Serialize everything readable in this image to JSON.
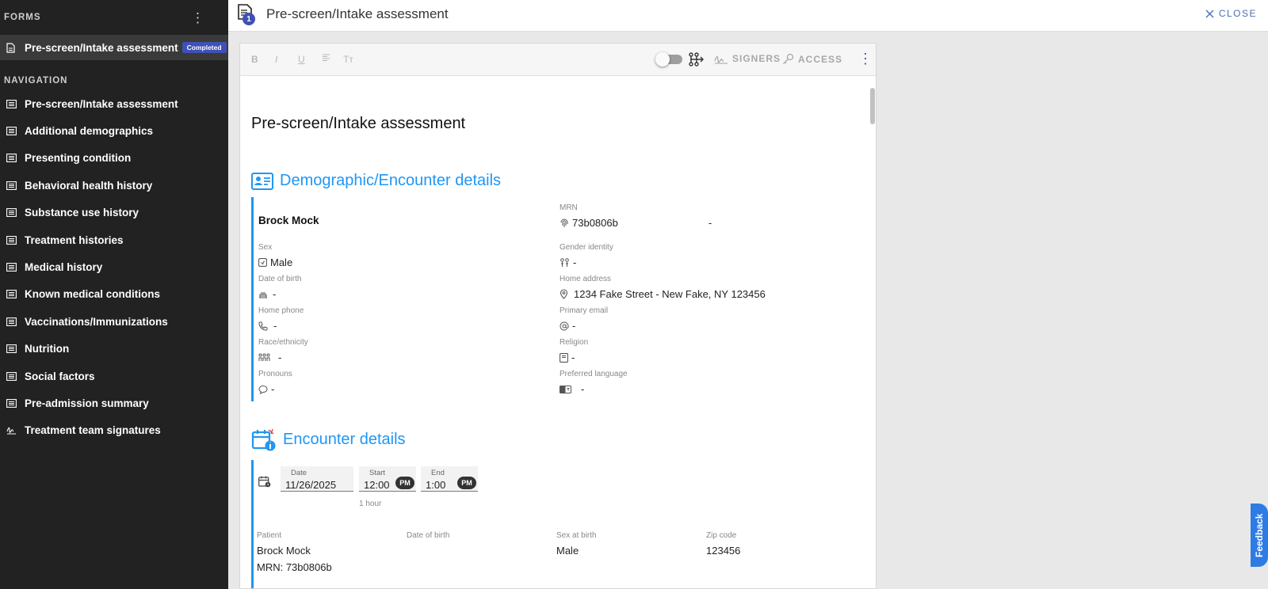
{
  "sidebar": {
    "forms_title": "FORMS",
    "form_item": {
      "label": "Pre-screen/Intake assessment",
      "badge": "Completed"
    },
    "nav_title": "NAVIGATION",
    "nav_items": [
      {
        "label": "Pre-screen/Intake assessment",
        "icon": "list-icon"
      },
      {
        "label": "Additional demographics",
        "icon": "list-icon"
      },
      {
        "label": "Presenting condition",
        "icon": "list-icon"
      },
      {
        "label": "Behavioral health history",
        "icon": "list-icon"
      },
      {
        "label": "Substance use history",
        "icon": "list-icon"
      },
      {
        "label": "Treatment histories",
        "icon": "list-icon"
      },
      {
        "label": "Medical history",
        "icon": "list-icon"
      },
      {
        "label": "Known medical conditions",
        "icon": "list-icon"
      },
      {
        "label": "Vaccinations/Immunizations",
        "icon": "list-icon"
      },
      {
        "label": "Nutrition",
        "icon": "list-icon"
      },
      {
        "label": "Social factors",
        "icon": "list-icon"
      },
      {
        "label": "Pre-admission summary",
        "icon": "list-icon"
      },
      {
        "label": "Treatment team signatures",
        "icon": "signature-icon"
      }
    ]
  },
  "topbar": {
    "title": "Pre-screen/Intake assessment",
    "doc_count": "1",
    "close_label": "CLOSE"
  },
  "toolbar": {
    "bold": "B",
    "italic": "I",
    "underline": "U",
    "clear_format": "Tт",
    "signers_label": "SIGNERS",
    "access_label": "ACCESS"
  },
  "document": {
    "title": "Pre-screen/Intake assessment",
    "demographics": {
      "heading": "Demographic/Encounter details",
      "name": "Brock Mock",
      "mrn_label": "MRN",
      "mrn_value": "73b0806b",
      "mrn_extra": "-",
      "sex_label": "Sex",
      "sex_value": "Male",
      "gender_label": "Gender identity",
      "gender_value": "-",
      "dob_label": "Date of birth",
      "dob_value": "-",
      "address_label": "Home address",
      "address_value": "1234 Fake Street - New Fake, NY 123456",
      "phone_label": "Home phone",
      "phone_value": "-",
      "email_label": "Primary email",
      "email_value": "-",
      "race_label": "Race/ethnicity",
      "race_value": "-",
      "religion_label": "Religion",
      "religion_value": "-",
      "pronouns_label": "Pronouns",
      "pronouns_value": "-",
      "language_label": "Preferred language",
      "language_value": "-"
    },
    "encounter": {
      "heading": "Encounter details",
      "date_label": "Date",
      "date_value": "11/26/2025",
      "start_label": "Start",
      "start_value": "12:00",
      "start_ampm": "PM",
      "end_label": "End",
      "end_value": "1:00",
      "end_ampm": "PM",
      "duration": "1 hour",
      "patient_label": "Patient",
      "patient_name": "Brock Mock",
      "patient_mrn": "MRN: 73b0806b",
      "dob_label": "Date of birth",
      "sab_label": "Sex at birth",
      "sab_value": "Male",
      "zip_label": "Zip code",
      "zip_value": "123456"
    }
  },
  "feedback_label": "Feedback",
  "colors": {
    "sidebar_bg": "#222222",
    "accent_blue": "#2196f3",
    "badge_indigo": "#3f51b5"
  }
}
